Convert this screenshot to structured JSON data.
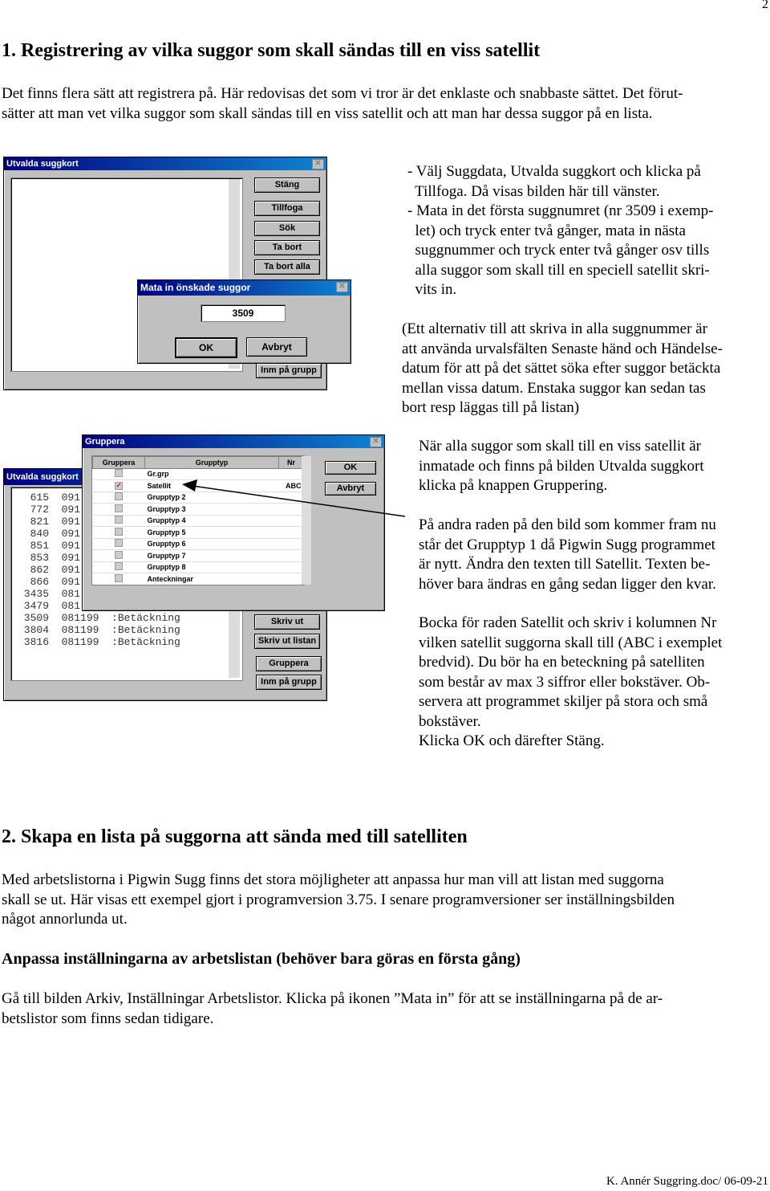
{
  "page_number": "2",
  "section1": {
    "heading": "1. Registrering av vilka suggor som skall sändas till en viss satellit",
    "intro": [
      "Det finns flera sätt att registrera på. Här redovisas det som vi tror är det enklaste och snabbaste sättet. Det förut-",
      "sätter att man vet vilka suggor som skall sändas till en viss satellit och att man har dessa suggor på en lista."
    ],
    "bullets": [
      "- Välj Suggdata, Utvalda suggkort och klicka på",
      "  Tillfoga. Då visas bilden här till vänster.",
      "- Mata in det första suggnumret (nr 3509 i exemp-",
      "  let) och tryck enter två gånger, mata in nästa",
      "  suggnummer och tryck enter två gånger osv tills",
      "  alla suggor som skall till en speciell satellit skri-",
      "  vits in."
    ],
    "alt": [
      "(Ett alternativ till att skriva in alla suggnummer är",
      "att använda urvalsfälten Senaste händ och Händelse-",
      "datum för att på det sättet söka efter suggor betäckta",
      "mellan vissa datum. Enstaka suggor kan sedan tas",
      "bort resp läggas till på listan)"
    ],
    "para_a": [
      "När alla suggor som skall till en viss satellit är",
      "inmatade och finns på bilden Utvalda suggkort",
      "klicka på knappen Gruppering."
    ],
    "para_b": [
      "På andra raden på den bild som kommer fram nu",
      "står det Grupptyp 1 då Pigwin Sugg programmet",
      "är nytt. Ändra den texten till Satellit. Texten be-",
      "höver bara ändras en gång sedan ligger den kvar."
    ],
    "para_c": [
      "Bocka för raden Satellit och skriv i kolumnen Nr",
      "vilken satellit suggorna skall till (ABC i exemplet",
      "bredvid). Du bör ha en beteckning på satelliten",
      "som består av max 3 siffror eller bokstäver. Ob-",
      "servera att programmet skiljer på stora och små",
      "bokstäver.",
      "Klicka OK och därefter Stäng."
    ]
  },
  "shot1": {
    "window_title": "Utvalda suggkort",
    "buttons": [
      "Stäng",
      "Tillfoga",
      "Sök",
      "Ta bort",
      "Ta bort alla",
      "Inm på grupp"
    ],
    "dialog_title": "Mata in önskade suggor",
    "input_value": "3509",
    "ok": "OK",
    "cancel": "Avbryt"
  },
  "shot2": {
    "window_title": "Utvalda suggkort",
    "rows": [
      "  615  091",
      "  772  091",
      "  821  091",
      "  840  091",
      "  851  091",
      "  853  091",
      "  862  091",
      "  866  091",
      " 3435  081",
      " 3479  081",
      " 3509  081199  :Betäckning",
      " 3804  081199  :Betäckning",
      " 3816  081199  :Betäckning"
    ],
    "buttons": [
      "Skriv ut",
      "Skriv ut listan",
      "Gruppera",
      "Inm på grupp"
    ],
    "dialog_title": "Gruppera",
    "columns": [
      "Gruppera",
      "Grupptyp",
      "Nr"
    ],
    "groups": [
      {
        "name": "Gr.grp",
        "checked": false,
        "nr": ""
      },
      {
        "name": "Satellit",
        "checked": true,
        "nr": "ABC"
      },
      {
        "name": "Grupptyp 2",
        "checked": false,
        "nr": ""
      },
      {
        "name": "Grupptyp 3",
        "checked": false,
        "nr": ""
      },
      {
        "name": "Grupptyp 4",
        "checked": false,
        "nr": ""
      },
      {
        "name": "Grupptyp 5",
        "checked": false,
        "nr": ""
      },
      {
        "name": "Grupptyp 6",
        "checked": false,
        "nr": ""
      },
      {
        "name": "Grupptyp 7",
        "checked": false,
        "nr": ""
      },
      {
        "name": "Grupptyp 8",
        "checked": false,
        "nr": ""
      },
      {
        "name": "Anteckningar",
        "checked": false,
        "nr": ""
      }
    ],
    "ok": "OK",
    "cancel": "Avbryt"
  },
  "section2": {
    "heading": "2. Skapa en lista på suggorna att sända med till satelliten",
    "intro": [
      "Med arbetslistorna i Pigwin Sugg finns det stora möjligheter att anpassa hur man vill att listan med suggorna",
      "skall se ut. Här visas ett exempel gjort i programversion 3.75. I senare programversioner ser inställningsbilden",
      "något annorlunda ut."
    ],
    "subheading": "Anpassa inställningarna av arbetslistan (behöver bara göras en första gång)",
    "para": [
      "Gå till bilden Arkiv, Inställningar Arbetslistor. Klicka på ikonen ”Mata in” för att se inställningarna på de ar-",
      "betslistor som finns sedan tidigare."
    ]
  },
  "footer": "K. Annér  Suggring.doc/  06-09-21"
}
